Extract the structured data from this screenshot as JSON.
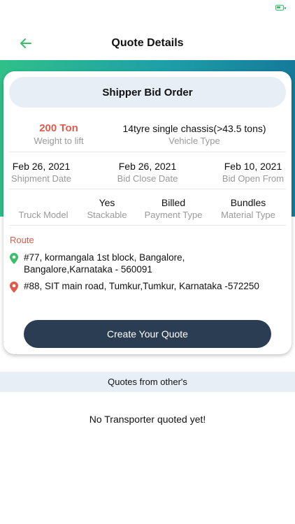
{
  "header": {
    "title": "Quote Details",
    "back_icon": "arrow-left-icon",
    "accent_color": "#3dbf6a"
  },
  "card": {
    "title": "Shipper Bid Order",
    "row1": [
      {
        "value": "200 Ton",
        "label": "Weight to lift"
      },
      {
        "value": "14tyre single chassis(>43.5 tons)",
        "label": "Vehicle Type"
      }
    ],
    "row2": [
      {
        "value": "Feb 26, 2021",
        "label": "Shipment Date"
      },
      {
        "value": "Feb 26, 2021",
        "label": "Bid Close Date"
      },
      {
        "value": "Feb 10, 2021",
        "label": "Bid Open From"
      }
    ],
    "row3": [
      {
        "value": "",
        "label": "Truck Model"
      },
      {
        "value": "Yes",
        "label": "Stackable"
      },
      {
        "value": "Billed",
        "label": "Payment Type"
      },
      {
        "value": "Bundles",
        "label": "Material Type"
      }
    ],
    "route": {
      "title": "Route",
      "pickup": "#77, kormangala 1st block, Bangalore, Bangalore,Karnataka - 560091",
      "drop": "#88, SIT main road, Tumkur,Tumkur, Karnataka -572250"
    },
    "cta_label": "Create Your Quote"
  },
  "quotes": {
    "section_title": "Quotes from other's",
    "empty_message": "No Transporter quoted yet!"
  },
  "colors": {
    "accent_red": "#e05a4b",
    "pickup_pin": "#3dbf6a",
    "drop_pin": "#e05a4b",
    "button": "#2b3d52"
  }
}
